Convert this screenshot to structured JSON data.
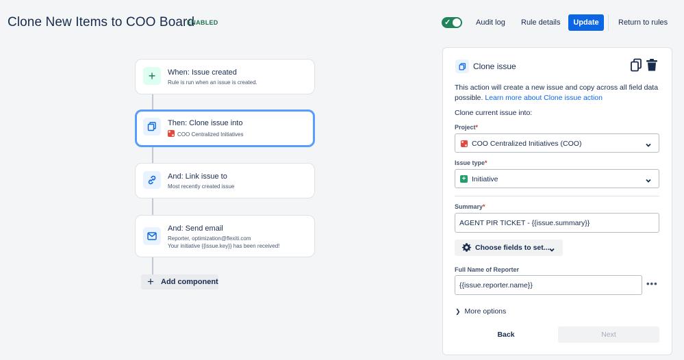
{
  "header": {
    "title": "Clone New Items to COO Board",
    "status_badge": "ENABLED",
    "audit_log": "Audit log",
    "rule_details": "Rule details",
    "update": "Update",
    "return_to_rules": "Return to rules",
    "toggle_on": true
  },
  "flow": {
    "nodes": [
      {
        "title": "When: Issue created",
        "subtitle": "Rule is run when an issue is created.",
        "icon": "plus-icon"
      },
      {
        "title": "Then: Clone issue into",
        "subtitle": "COO Centralized Initiatives",
        "icon": "copy-icon"
      },
      {
        "title": "And: Link issue to",
        "subtitle": "Most recently created issue",
        "icon": "link-icon"
      },
      {
        "title": "And: Send email",
        "subtitle": "Reporter, optimization@flexiti.com",
        "subtitle2": "Your initiative {{issue.key}} has been received!",
        "icon": "mail-icon"
      }
    ],
    "add_component": "Add component"
  },
  "panel": {
    "title": "Clone issue",
    "description": "This action will create a new issue and copy across all field data possible.",
    "learn_more": "Learn more about Clone issue action",
    "section_label": "Clone current issue into:",
    "project_label": "Project",
    "project_value": "COO Centralized Initiatives (COO)",
    "issue_type_label": "Issue type",
    "issue_type_value": "Initiative",
    "summary_label": "Summary",
    "summary_value": "AGENT PIR TICKET - {{issue.summary}}",
    "choose_fields": "Choose fields to set...",
    "reporter_label": "Full Name of Reporter",
    "reporter_value": "{{issue.reporter.name}}",
    "more_options": "More options",
    "back": "Back",
    "next": "Next",
    "required_marker": "*"
  },
  "colors": {
    "accent": "#0c66e4",
    "enabled": "#216e4e",
    "toggle": "#1f845a",
    "selected_border": "#579dff"
  }
}
